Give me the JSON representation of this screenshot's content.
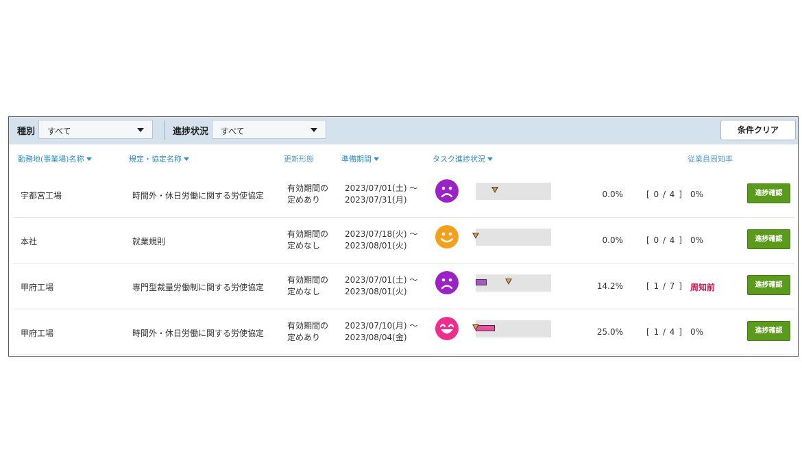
{
  "filters": {
    "type_label": "種別",
    "type_value": "すべて",
    "progress_label": "進捗状況",
    "progress_value": "すべて",
    "clear_label": "条件クリア"
  },
  "headers": {
    "location": "勤務地(事業場)名称",
    "regulation": "規定・協定名称",
    "update_type": "更新形態",
    "prep_period": "準備期間",
    "task_progress": "タスク進捗状況",
    "awareness": "従業員周知率"
  },
  "rows": [
    {
      "location": "宇都宮工場",
      "regulation": "時間外・休日労働に関する労使協定",
      "update_line1": "有効期間の",
      "update_line2": "定めあり",
      "period_start": "2023/07/01(土) ～",
      "period_end": "2023/07/31(月)",
      "face": "sad-face-icon",
      "face_color": "#9b22c7",
      "progress": 0.0,
      "expected": 0.25,
      "fill_color": "#a855c8",
      "progress_text": "0.0%",
      "count_text": "[ 0 / 4 ]",
      "awareness": "0%",
      "awareness_alert": false,
      "action": "進捗確認"
    },
    {
      "location": "本社",
      "regulation": "就業規則",
      "update_line1": "有効期間の",
      "update_line2": "定めなし",
      "period_start": "2023/07/18(火) ～",
      "period_end": "2023/08/01(火)",
      "face": "smile-face-icon",
      "face_color": "#f5a01a",
      "progress": 0.0,
      "expected": 0.0,
      "fill_color": "#f5a01a",
      "progress_text": "0.0%",
      "count_text": "[ 0 / 4 ]",
      "awareness": "0%",
      "awareness_alert": false,
      "action": "進捗確認"
    },
    {
      "location": "甲府工場",
      "regulation": "専門型裁量労働制に関する労使協定",
      "update_line1": "有効期間の",
      "update_line2": "定めなし",
      "period_start": "2023/07/01(土) ～",
      "period_end": "2023/08/01(火)",
      "face": "sad-face-icon",
      "face_color": "#9b22c7",
      "progress": 0.142,
      "expected": 0.44,
      "fill_color": "#a855c8",
      "progress_text": "14.2%",
      "count_text": "[ 1 / 7 ]",
      "awareness": "周知前",
      "awareness_alert": true,
      "action": "進捗確認"
    },
    {
      "location": "甲府工場",
      "regulation": "時間外・休日労働に関する労使協定",
      "update_line1": "有効期間の",
      "update_line2": "定めあり",
      "period_start": "2023/07/10(月) ～",
      "period_end": "2023/08/04(金)",
      "face": "laughing-face-icon",
      "face_color": "#ee2d8c",
      "progress": 0.25,
      "expected": 0.0,
      "fill_color": "#ee4fa0",
      "progress_text": "25.0%",
      "count_text": "[ 1 / 4 ]",
      "awareness": "0%",
      "awareness_alert": false,
      "action": "進捗確認"
    }
  ]
}
